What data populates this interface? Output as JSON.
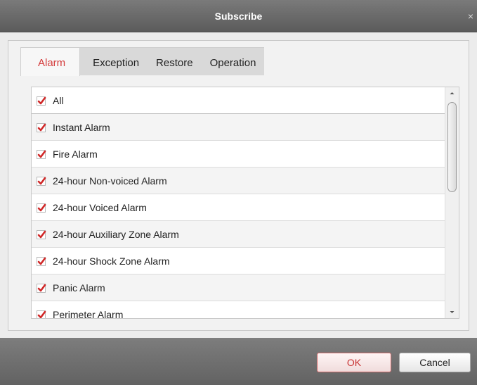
{
  "window": {
    "title": "Subscribe",
    "close_glyph": "×"
  },
  "tabs": [
    {
      "label": "Alarm",
      "active": true
    },
    {
      "label": "Exception",
      "active": false
    },
    {
      "label": "Restore",
      "active": false
    },
    {
      "label": "Operation",
      "active": false
    }
  ],
  "list": {
    "items": [
      {
        "label": "All",
        "checked": true
      },
      {
        "label": "Instant Alarm",
        "checked": true
      },
      {
        "label": "Fire Alarm",
        "checked": true
      },
      {
        "label": "24-hour Non-voiced Alarm",
        "checked": true
      },
      {
        "label": "24-hour Voiced Alarm",
        "checked": true
      },
      {
        "label": "24-hour Auxiliary Zone Alarm",
        "checked": true
      },
      {
        "label": "24-hour Shock Zone Alarm",
        "checked": true
      },
      {
        "label": "Panic Alarm",
        "checked": true
      },
      {
        "label": "Perimeter Alarm",
        "checked": true
      }
    ]
  },
  "buttons": {
    "ok_label": "OK",
    "cancel_label": "Cancel"
  },
  "colors": {
    "accent": "#d43b3b",
    "check": "#d02828",
    "titlebar": "#6a6a6a"
  },
  "icons": {
    "check": "checkmark-icon",
    "close": "close-icon",
    "scroll_up": "arrow-up-icon",
    "scroll_down": "arrow-down-icon"
  }
}
